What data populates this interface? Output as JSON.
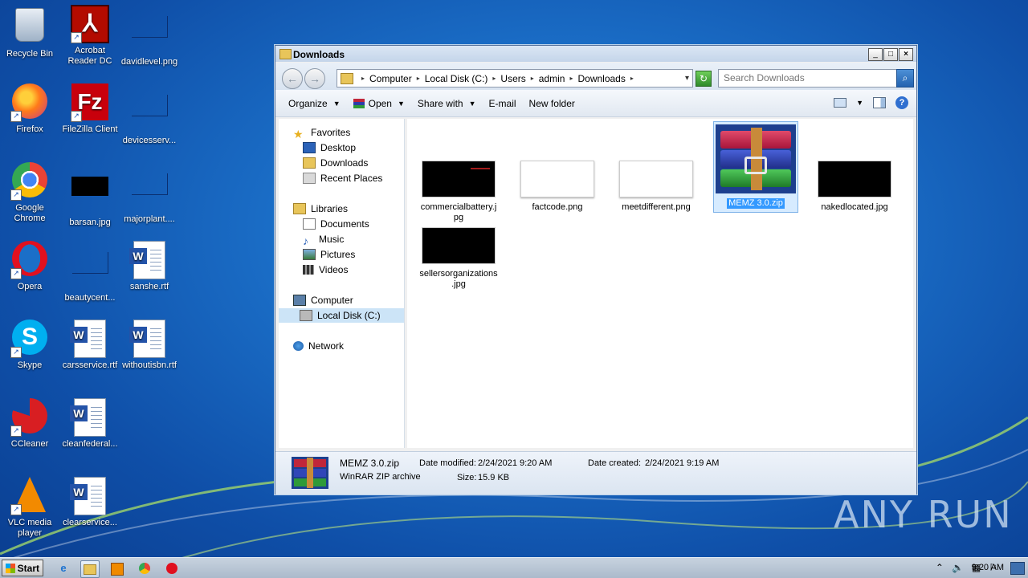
{
  "desktop": {
    "icons": [
      {
        "label": "Recycle Bin"
      },
      {
        "label": "Acrobat Reader DC"
      },
      {
        "label": "davidlevel.png"
      },
      {
        "label": "Firefox"
      },
      {
        "label": "FileZilla Client"
      },
      {
        "label": "devicesserv..."
      },
      {
        "label": "Google Chrome"
      },
      {
        "label": "barsan.jpg"
      },
      {
        "label": "majorplant...."
      },
      {
        "label": "Opera"
      },
      {
        "label": "beautycent..."
      },
      {
        "label": "sanshe.rtf"
      },
      {
        "label": "Skype"
      },
      {
        "label": "carsservice.rtf"
      },
      {
        "label": "withoutisbn.rtf"
      },
      {
        "label": "CCleaner"
      },
      {
        "label": "cleanfederal..."
      },
      {
        "label": "VLC media player"
      },
      {
        "label": "clearservice..."
      }
    ],
    "watermark": "ANY RUN"
  },
  "window": {
    "title": "Downloads",
    "controls": {
      "minimize": "_",
      "maximize": "□",
      "close": "×"
    },
    "address": {
      "crumbs": [
        "Computer",
        "Local Disk (C:)",
        "Users",
        "admin",
        "Downloads"
      ]
    },
    "search": {
      "placeholder": "Search Downloads"
    },
    "toolbar": {
      "organize": "Organize",
      "open": "Open",
      "share_with": "Share with",
      "email": "E-mail",
      "new_folder": "New folder"
    },
    "nav": {
      "favorites": "Favorites",
      "desktop": "Desktop",
      "downloads": "Downloads",
      "recent_places": "Recent Places",
      "libraries": "Libraries",
      "documents": "Documents",
      "music": "Music",
      "pictures": "Pictures",
      "videos": "Videos",
      "computer": "Computer",
      "local_disk": "Local Disk (C:)",
      "network": "Network"
    },
    "files": [
      {
        "name": "commercialbattery.jpg",
        "name_l1": "commercialbattery.j",
        "name_l2": "pg",
        "kind": "black"
      },
      {
        "name": "factcode.png",
        "kind": "white"
      },
      {
        "name": "meetdifferent.png",
        "kind": "white"
      },
      {
        "name": "MEMZ 3.0.zip",
        "kind": "rar",
        "selected": true
      },
      {
        "name": "nakedlocated.jpg",
        "kind": "black"
      },
      {
        "name": "sellersorganizations.jpg",
        "name_l1": "sellersorganizations",
        "name_l2": ".jpg",
        "kind": "black"
      }
    ],
    "status": {
      "name": "MEMZ 3.0.zip",
      "type": "WinRAR ZIP archive",
      "date_modified_label": "Date modified:",
      "date_modified": "2/24/2021 9:20 AM",
      "date_created_label": "Date created:",
      "date_created": "2/24/2021 9:19 AM",
      "size_label": "Size:",
      "size": "15.9 KB"
    }
  },
  "taskbar": {
    "start": "Start",
    "clock": "9:20 AM"
  }
}
